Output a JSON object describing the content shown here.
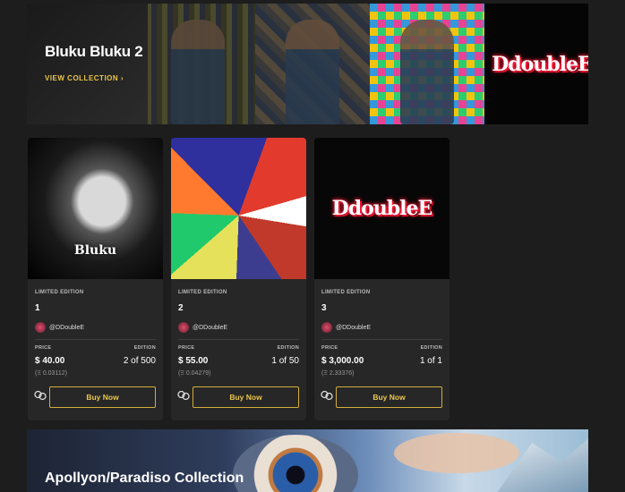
{
  "banner": {
    "title": "Bluku Bluku 2",
    "link_label": "VIEW COLLECTION ›",
    "logo_text": "DdoubleE"
  },
  "cards": [
    {
      "art_text": "Bluku",
      "tag": "LIMITED EDITION",
      "number": "1",
      "creator": "@DDoubleE",
      "price_label": "PRICE",
      "edition_label": "EDITION",
      "price": "$ 40.00",
      "edition": "2 of 500",
      "eth": "(Ξ 0.03112)",
      "buy_label": "Buy Now"
    },
    {
      "art_text": "",
      "tag": "LIMITED EDITION",
      "number": "2",
      "creator": "@DDoubleE",
      "price_label": "PRICE",
      "edition_label": "EDITION",
      "price": "$ 55.00",
      "edition": "1 of 50",
      "eth": "(Ξ 0.04279)",
      "buy_label": "Buy Now"
    },
    {
      "art_text": "DdoubleE",
      "tag": "LIMITED EDITION",
      "number": "3",
      "creator": "@DDoubleE",
      "price_label": "PRICE",
      "edition_label": "EDITION",
      "price": "$ 3,000.00",
      "edition": "1 of 1",
      "eth": "(Ξ 2.33376)",
      "buy_label": "Buy Now"
    }
  ],
  "bottom_banner": {
    "title": "Apollyon/Paradiso Collection"
  },
  "colors": {
    "accent": "#e9c64d",
    "background": "#1d1d1d",
    "card": "#272727"
  }
}
